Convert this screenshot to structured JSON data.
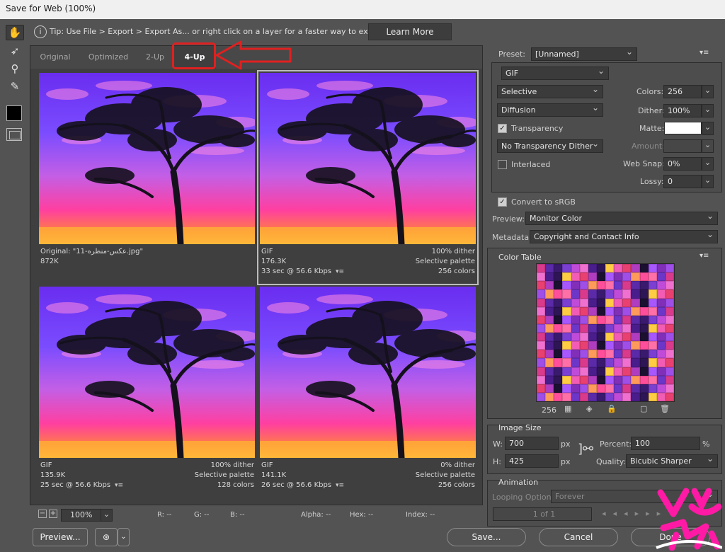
{
  "window": {
    "title": "Save for Web (100%)"
  },
  "tip": {
    "text": "Tip: Use File > Export > Export As...   or right click on a layer for a faster way to export assets",
    "learn_more": "Learn More"
  },
  "tabs": [
    "Original",
    "Optimized",
    "2-Up",
    "4-Up"
  ],
  "active_tab": "4-Up",
  "panels": [
    {
      "line1_left": "Original: \"عکس-منظره-11.jpg\"",
      "line1_right": "",
      "line2_left": "872K",
      "line2_right": "",
      "line3_left": "",
      "line3_right": ""
    },
    {
      "line1_left": "GIF",
      "line1_right": "100% dither",
      "line2_left": "176.3K",
      "line2_right": "Selective palette",
      "line3_left": "33 sec @ 56.6 Kbps",
      "line3_right": "256 colors"
    },
    {
      "line1_left": "GIF",
      "line1_right": "100% dither",
      "line2_left": "135.9K",
      "line2_right": "Selective palette",
      "line3_left": "25 sec @ 56.6 Kbps",
      "line3_right": "128 colors"
    },
    {
      "line1_left": "GIF",
      "line1_right": "0% dither",
      "line2_left": "141.1K",
      "line2_right": "Selective palette",
      "line3_left": "26 sec @ 56.6 Kbps",
      "line3_right": "256 colors"
    }
  ],
  "statusbar": {
    "zoom": "100%",
    "r": "R: --",
    "g": "G: --",
    "b": "B: --",
    "alpha": "Alpha: --",
    "hex": "Hex: --",
    "index": "Index: --"
  },
  "buttons": {
    "preview": "Preview...",
    "save": "Save...",
    "cancel": "Cancel",
    "done": "Done"
  },
  "settings": {
    "preset_label": "Preset:",
    "preset": "[Unnamed]",
    "format": "GIF",
    "reduction": "Selective",
    "dither_algorithm": "Diffusion",
    "transparency_label": "Transparency",
    "transparency_dither": "No Transparency Dither",
    "interlaced_label": "Interlaced",
    "colors_label": "Colors:",
    "colors": "256",
    "dither_label": "Dither:",
    "dither": "100%",
    "matte_label": "Matte:",
    "amount_label": "Amount:",
    "amount": "",
    "websnap_label": "Web Snap:",
    "websnap": "0%",
    "lossy_label": "Lossy:",
    "lossy": "0",
    "convert_srgb_label": "Convert to sRGB",
    "preview_label": "Preview:",
    "preview_mode": "Monitor Color",
    "metadata_label": "Metadata:",
    "metadata": "Copyright and Contact Info",
    "transparency_checked": true,
    "interlaced_checked": false,
    "convert_srgb_checked": true
  },
  "color_table": {
    "title": "Color Table",
    "count": "256"
  },
  "image_size": {
    "title": "Image Size",
    "w_label": "W:",
    "w": "700",
    "w_unit": "px",
    "h_label": "H:",
    "h": "425",
    "h_unit": "px",
    "percent_label": "Percent:",
    "percent": "100",
    "percent_unit": "%",
    "quality_label": "Quality:",
    "quality": "Bicubic Sharper"
  },
  "animation": {
    "title": "Animation",
    "looping_label": "Looping Options:",
    "looping": "Forever",
    "frame": "1 of 1"
  },
  "colors": {
    "accent_red": "#e02020",
    "logo_pink": "#ff1aa5"
  }
}
